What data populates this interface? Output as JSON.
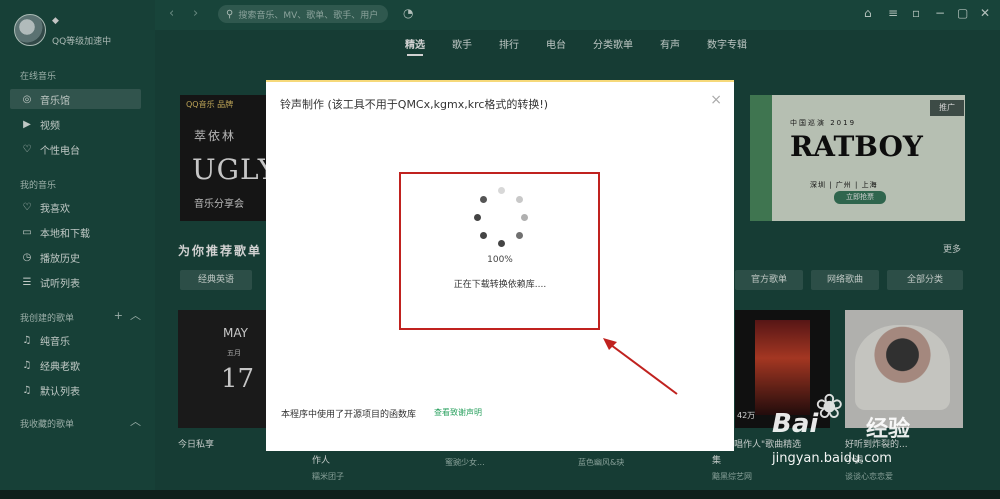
{
  "sidebar": {
    "user_level": "QQ等级加速中",
    "online_music_title": "在线音乐",
    "online_items": [
      {
        "label": "音乐馆",
        "icon": "music-hall-icon"
      },
      {
        "label": "视频",
        "icon": "video-icon"
      },
      {
        "label": "个性电台",
        "icon": "radio-icon"
      }
    ],
    "my_music_title": "我的音乐",
    "my_items": [
      {
        "label": "我喜欢",
        "icon": "heart-icon"
      },
      {
        "label": "本地和下载",
        "icon": "monitor-icon"
      },
      {
        "label": "播放历史",
        "icon": "history-icon"
      },
      {
        "label": "试听列表",
        "icon": "list-icon"
      }
    ],
    "created_title": "我创建的歌单",
    "created_items": [
      {
        "label": "纯音乐",
        "icon": "note-icon"
      },
      {
        "label": "经典老歌",
        "icon": "note-icon"
      },
      {
        "label": "默认列表",
        "icon": "note-icon"
      }
    ],
    "collected_title": "我收藏的歌单"
  },
  "topbar": {
    "search_placeholder": "搜索音乐、MV、歌单、歌手、用户"
  },
  "tabs": [
    "精选",
    "歌手",
    "排行",
    "电台",
    "分类歌单",
    "有声",
    "数字专辑"
  ],
  "active_tab": "精选",
  "banners": {
    "left_brand": "QQ音乐 品牌",
    "left_name": "萃依林",
    "left_ugly": "UGLY",
    "left_sub": "音乐分享会",
    "right_china": "中国巡演 2019",
    "right_title": "RATBOY",
    "right_cities": "深圳 | 广州 | 上海",
    "right_ticket": "立即抢票",
    "promo": "推广"
  },
  "recommend": {
    "title": "为你推荐歌单",
    "more": "更多",
    "categories_left": [
      "经典英语"
    ],
    "categories_right": [
      "官方歌单",
      "网络歌曲",
      "全部分类"
    ]
  },
  "cards": {
    "c1_month": "MAY",
    "c1_month_cn": "五月",
    "c1_day": "17",
    "c1_title": "今日私享",
    "c2_title": "作人",
    "c2_sub": "糯米团子",
    "c3_sub": "蜜豌少女...",
    "c4_sub": "蓝色幽风&玦",
    "c5_plays": "42万",
    "c5_title": "星唱作人\"歌曲精选",
    "c5_title2": "集",
    "c5_sub": "黯黑综艺网",
    "c6_title": "好听到炸裂的...",
    "c6_title2": "小调",
    "c6_sub": "谈谈心恋恋爱"
  },
  "dialog": {
    "title": "铃声制作 (该工具不用于QMCx,kgmx,krc格式的转换!)",
    "close": "×",
    "progress_percent": "100%",
    "status": "正在下载转换依赖库....",
    "credit": "本程序中使用了开源项目的函数库",
    "credit_link": "查看致谢声明"
  },
  "watermark": {
    "brand": "Bai",
    "brand_cn": "经验",
    "url": "jingyan.baidu.com"
  },
  "colors": {
    "sidebar_bg": "#1d4f44",
    "content_bg": "#1b4a40",
    "highlight_red": "#c0221f",
    "link_green": "#2aa15f"
  }
}
